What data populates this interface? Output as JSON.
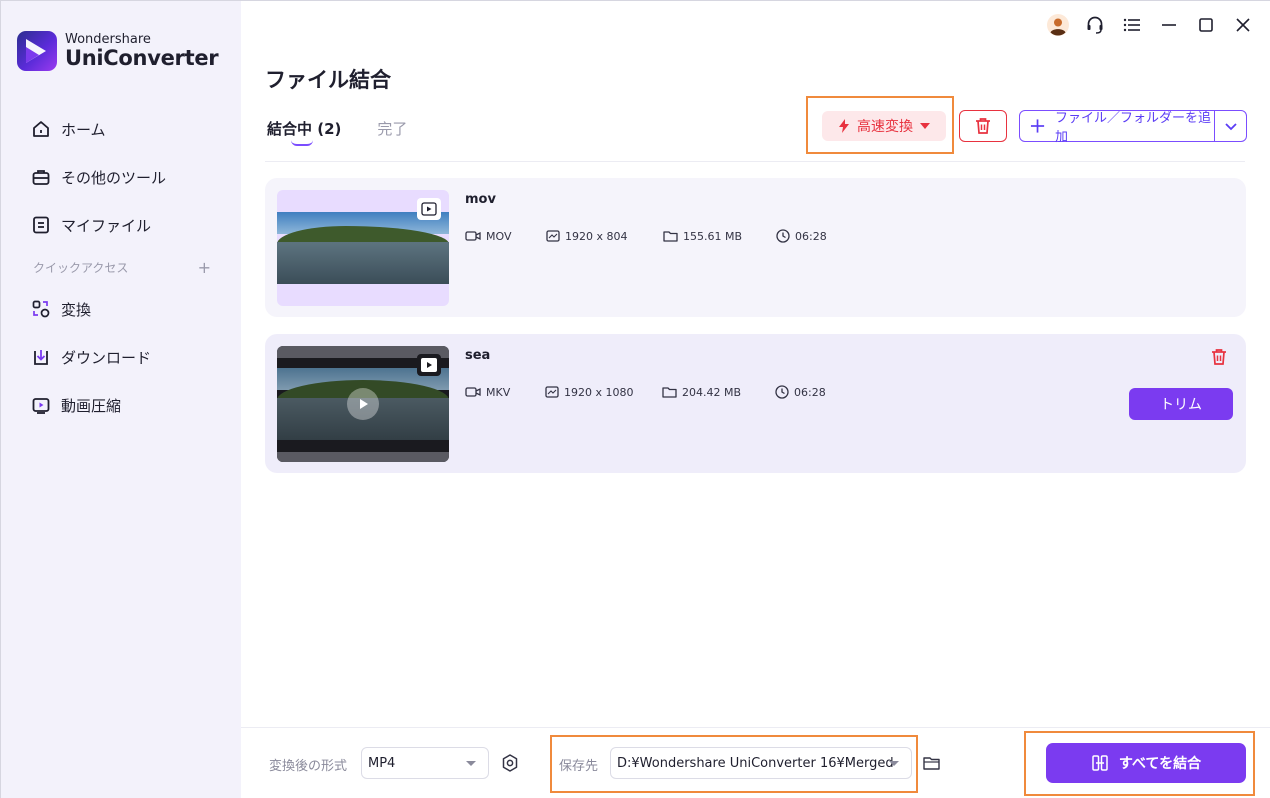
{
  "app": {
    "brand": "Wondershare",
    "product": "UniConverter"
  },
  "sidebar": {
    "items": [
      {
        "label": "ホーム",
        "icon": "home-icon"
      },
      {
        "label": "その他のツール",
        "icon": "toolbox-icon"
      },
      {
        "label": "マイファイル",
        "icon": "my-files-icon"
      }
    ],
    "section_label": "クイックアクセス",
    "section_add": "+",
    "quick_items": [
      {
        "label": "変換",
        "icon": "convert-icon"
      },
      {
        "label": "ダウンロード",
        "icon": "download-icon"
      },
      {
        "label": "動画圧縮",
        "icon": "compress-icon"
      }
    ]
  },
  "titlebar": {
    "icons": [
      "avatar-icon",
      "headset-icon",
      "menu-icon",
      "minimize-icon",
      "maximize-icon",
      "close-icon"
    ]
  },
  "page": {
    "title": "ファイル結合",
    "tabs": [
      {
        "label": "結合中 (2)",
        "active": true
      },
      {
        "label": "完了",
        "active": false
      }
    ]
  },
  "toolbar": {
    "speed_label": "高速変換",
    "add_label": "ファイル／フォルダーを追加"
  },
  "files": [
    {
      "name": "mov",
      "format": "MOV",
      "resolution": "1920 x 804",
      "size": "155.61 MB",
      "duration": "06:28",
      "selected": false
    },
    {
      "name": "sea",
      "format": "MKV",
      "resolution": "1920 x 1080",
      "size": "204.42 MB",
      "duration": "06:28",
      "selected": true,
      "trim_label": "トリム"
    }
  ],
  "footer": {
    "format_label": "変換後の形式",
    "format_value": "MP4",
    "save_label": "保存先",
    "save_path": "D:¥Wondershare UniConverter 16¥Merged",
    "merge_label": "すべてを結合"
  },
  "colors": {
    "accent": "#7B3BF0",
    "danger": "#E8323F",
    "highlight": "#F08A3C",
    "sidebar_bg": "#F3F2FB"
  }
}
